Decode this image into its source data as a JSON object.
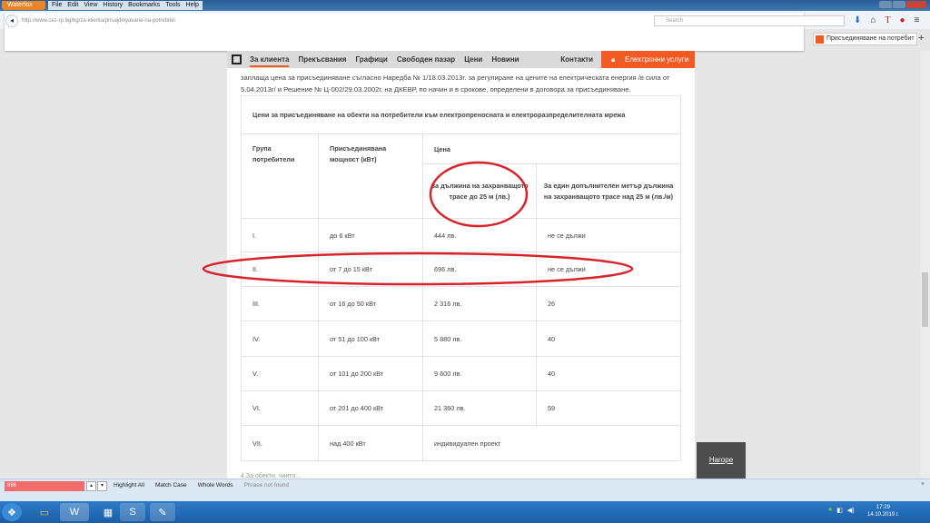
{
  "browser": {
    "brand": "Waterfox",
    "menu": [
      "File",
      "Edit",
      "View",
      "History",
      "Bookmarks",
      "Tools",
      "Help"
    ],
    "url": "http://www.cez-rp.bg/bg/za-klienta/prisajdinyavane-na-potrebitel",
    "search_placeholder": "Search",
    "tab_title": "Присъединяване на потребит",
    "new_tab": "+"
  },
  "site": {
    "nav": [
      "За клиента",
      "Прекъсвания",
      "Графици",
      "Свободен пазар",
      "Цени",
      "Новини"
    ],
    "contacts": "Контакти",
    "eservices": "Електронни услуги",
    "back_to_top": "Нагоре"
  },
  "content": {
    "paragraph": "заплаща цена за присъединяване съгласно Наредба № 1/18.03.2013г. за регулиране на цените на електрическата енергия /в сила от 5.04.2013г/ и Решение № Ц-002/29.03.2002г. на ДКЕВР, по начин и в срокове, определени в договора за присъединяване.",
    "table": {
      "title": "Цени за присъединяване на обекти на потребители към електропреносната и електроразпределителната мрежа",
      "headers": {
        "group": "Група потребители",
        "power": "Присъединявана мощност (кВт)",
        "price": "Цена",
        "price_up_to_25": "За дължина на захранващото трасе до 25 м (лв.)",
        "price_extra_m": "За един допълнителен метър дължина на захранващото трасе над 25 м (лв./м)"
      },
      "rows": [
        {
          "group": "I.",
          "power": "до 6 кВт",
          "price": "444 лв.",
          "extra": "не се дължи"
        },
        {
          "group": "II.",
          "power": "от 7 до 15 кВт",
          "price": "696 лв.",
          "extra": "не се дължи"
        },
        {
          "group": "III.",
          "power": "от 16 до 50 кВт",
          "price": "2 316 лв.",
          "extra": "26"
        },
        {
          "group": "IV.",
          "power": "от 51 до 100 кВт",
          "price": "5 880 лв.",
          "extra": "40"
        },
        {
          "group": "V.",
          "power": "от 101 до 200 кВт",
          "price": "9 600 лв.",
          "extra": "40"
        },
        {
          "group": "VI.",
          "power": "от 201 до 400 кВт",
          "price": "21 360 лв.",
          "extra": "59"
        },
        {
          "group": "VII.",
          "power": "над 400 кВт",
          "price": "индивидуален проект"
        }
      ]
    },
    "cut_text": "4.За обекти, чиито..."
  },
  "findbar": {
    "query": "696",
    "highlight_all": "Highlight All",
    "match_case": "Match Case",
    "whole_words": "Whole Words",
    "status": "Phrase not found"
  },
  "taskbar": {
    "time": "17:29",
    "date": "14.10.2019 г."
  },
  "colors": {
    "accent": "#f15a22",
    "annotation": "#d9232a"
  }
}
